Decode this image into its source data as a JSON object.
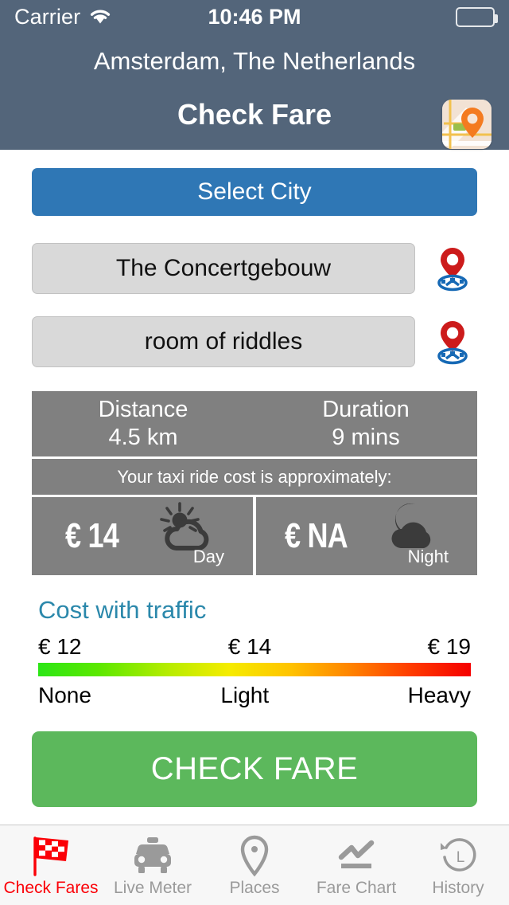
{
  "status_bar": {
    "carrier": "Carrier",
    "wifi_icon": "wifi-icon",
    "time": "10:46 PM",
    "battery_icon": "battery-full-icon"
  },
  "header": {
    "city": "Amsterdam, The Netherlands",
    "title": "Check Fare",
    "map_icon": "map-pin-thumbnail-icon",
    "background_color": "#53657a"
  },
  "form": {
    "select_city_label": "Select City",
    "select_city_color": "#2f77b5",
    "origin": {
      "value": "The Concertgebouw",
      "placeholder": "The Concertgebouw",
      "pin_icon": "map-marker-icon"
    },
    "destination": {
      "value": "room of riddles",
      "placeholder": "room of riddles",
      "pin_icon": "map-marker-icon"
    }
  },
  "trip": {
    "distance_label": "Distance",
    "distance_value": "4.5 km",
    "duration_label": "Duration",
    "duration_value": "9 mins",
    "approx_text": "Your taxi ride cost is approximately:",
    "day": {
      "amount": "€ 14",
      "caption": "Day",
      "icon": "sun-cloud-icon"
    },
    "night": {
      "amount": "€ NA",
      "caption": "Night",
      "icon": "moon-cloud-icon"
    },
    "panel_color": "#808080"
  },
  "traffic": {
    "title": "Cost with traffic",
    "title_color": "#2b88ab",
    "prices": [
      "€ 12",
      "€ 14",
      "€ 19"
    ],
    "levels": [
      "None",
      "Light",
      "Heavy"
    ],
    "gradient_from": "#2ce616",
    "gradient_to": "#f50000"
  },
  "action": {
    "check_fare_label": "CHECK FARE",
    "color": "#5cb85c"
  },
  "tabbar": {
    "active_color": "#fb0007",
    "inactive_color": "#9a9a9a",
    "items": [
      {
        "label": "Check Fares",
        "icon": "checkered-flag-icon",
        "active": true
      },
      {
        "label": "Live Meter",
        "icon": "taxi-icon",
        "active": false
      },
      {
        "label": "Places",
        "icon": "map-pin-icon",
        "active": false
      },
      {
        "label": "Fare Chart",
        "icon": "chart-line-icon",
        "active": false
      },
      {
        "label": "History",
        "icon": "clock-history-icon",
        "active": false
      }
    ]
  }
}
